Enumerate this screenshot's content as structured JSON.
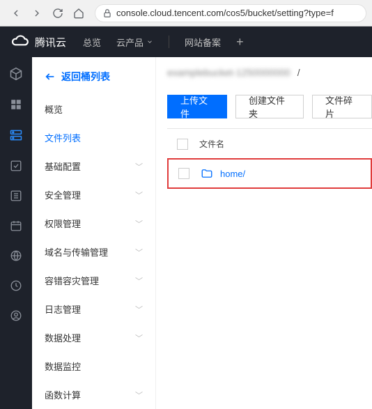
{
  "browser": {
    "url": "console.cloud.tencent.com/cos5/bucket/setting?type=f"
  },
  "topnav": {
    "brand": "腾讯云",
    "overview": "总览",
    "products": "云产品",
    "beian": "网站备案"
  },
  "sidebar": {
    "back": "返回桶列表",
    "items": [
      {
        "label": "概览",
        "expandable": false,
        "active": false
      },
      {
        "label": "文件列表",
        "expandable": false,
        "active": true
      },
      {
        "label": "基础配置",
        "expandable": true,
        "active": false
      },
      {
        "label": "安全管理",
        "expandable": true,
        "active": false
      },
      {
        "label": "权限管理",
        "expandable": true,
        "active": false
      },
      {
        "label": "域名与传输管理",
        "expandable": true,
        "active": false
      },
      {
        "label": "容错容灾管理",
        "expandable": true,
        "active": false
      },
      {
        "label": "日志管理",
        "expandable": true,
        "active": false
      },
      {
        "label": "数据处理",
        "expandable": true,
        "active": false
      },
      {
        "label": "数据监控",
        "expandable": false,
        "active": false
      },
      {
        "label": "函数计算",
        "expandable": true,
        "active": false
      }
    ]
  },
  "breadcrumb": {
    "bucket": "examplebucket-1250000000",
    "sep": "/"
  },
  "actions": {
    "upload": "上传文件",
    "create_folder": "创建文件夹",
    "fragments": "文件碎片"
  },
  "table": {
    "header_name": "文件名",
    "rows": [
      {
        "name": "home/",
        "type": "folder",
        "highlight": true
      }
    ]
  }
}
